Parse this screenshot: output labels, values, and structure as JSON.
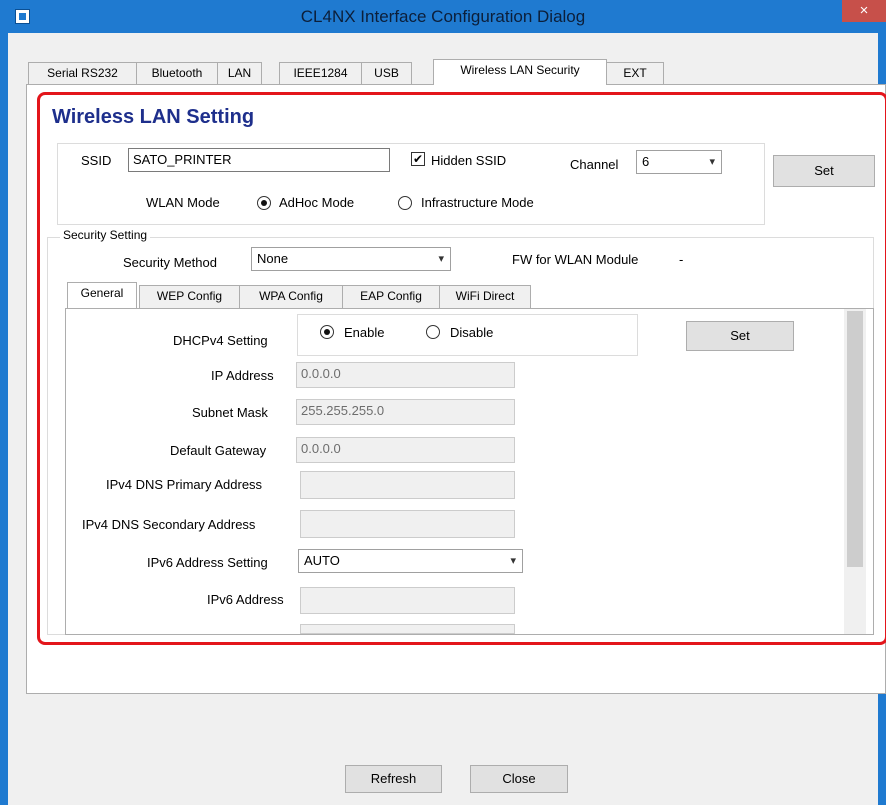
{
  "window": {
    "title": "CL4NX Interface Configuration Dialog",
    "close_glyph": "×"
  },
  "tabs": [
    "Serial RS232",
    "Bluetooth",
    "LAN",
    "IEEE1284",
    "USB",
    "Wireless LAN Security",
    "EXT"
  ],
  "active_tab": "Wireless LAN Security",
  "section_title": "Wireless LAN Setting",
  "wlan": {
    "ssid_label": "SSID",
    "ssid_value": "SATO_PRINTER",
    "hidden_ssid_label": "Hidden SSID",
    "hidden_ssid_checked": true,
    "check_glyph": "✔",
    "channel_label": "Channel",
    "channel_value": "6",
    "set_label": "Set",
    "mode_label": "WLAN Mode",
    "mode_adhoc": "AdHoc Mode",
    "mode_infra": "Infrastructure Mode",
    "mode_selected": "AdHoc Mode"
  },
  "security": {
    "group_label": "Security Setting",
    "method_label": "Security Method",
    "method_value": "None",
    "fw_label": "FW for WLAN Module",
    "fw_value": "-"
  },
  "inner_tabs": [
    "General",
    "WEP Config",
    "WPA Config",
    "EAP Config",
    "WiFi Direct"
  ],
  "active_inner_tab": "General",
  "general": {
    "dhcp_label": "DHCPv4 Setting",
    "dhcp_enable": "Enable",
    "dhcp_disable": "Disable",
    "dhcp_selected": "Enable",
    "set_label": "Set",
    "ip_label": "IP Address",
    "ip_value": "0.0.0.0",
    "subnet_label": "Subnet Mask",
    "subnet_value": "255.255.255.0",
    "gateway_label": "Default Gateway",
    "gateway_value": "0.0.0.0",
    "dns_primary_label": "IPv4 DNS Primary Address",
    "dns_primary_value": "",
    "dns_secondary_label": "IPv4 DNS Secondary Address",
    "dns_secondary_value": "",
    "ipv6_setting_label": "IPv6 Address Setting",
    "ipv6_setting_value": "AUTO",
    "ipv6_address_label": "IPv6 Address",
    "ipv6_address_value": ""
  },
  "footer": {
    "refresh_label": "Refresh",
    "close_label": "Close"
  },
  "colors": {
    "title_bar": "#1f7ad0",
    "highlight_border": "#e3151b",
    "section_title": "#1e2f8c",
    "close_button": "#c7504a"
  },
  "icons": {
    "dropdown": "▾"
  }
}
